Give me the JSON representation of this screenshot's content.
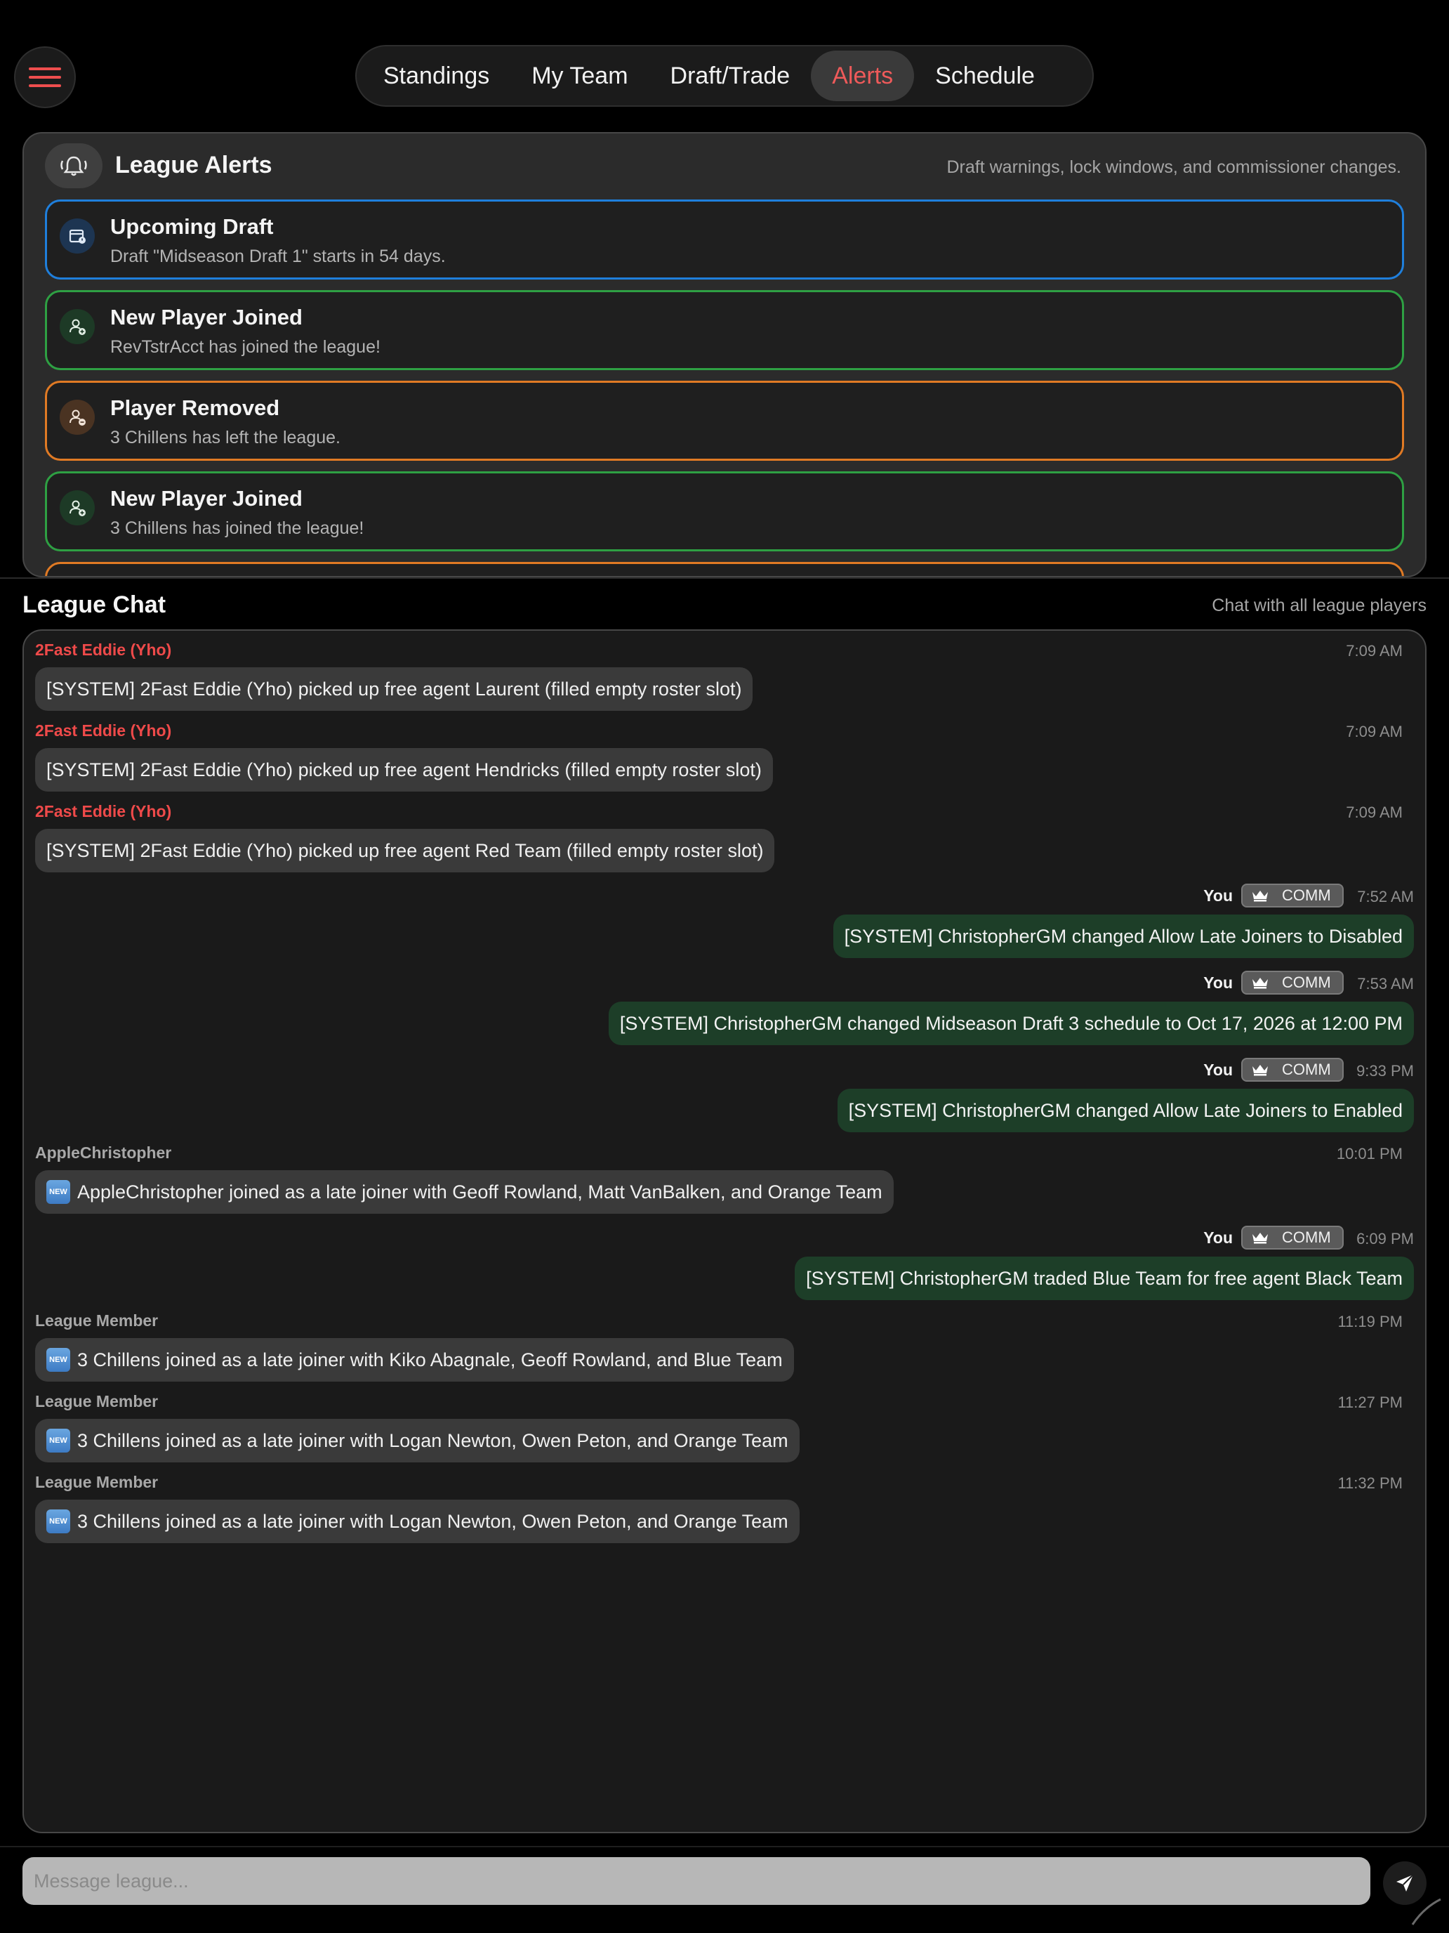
{
  "nav": {
    "tabs": [
      {
        "label": "Standings"
      },
      {
        "label": "My Team"
      },
      {
        "label": "Draft/Trade"
      },
      {
        "label": "Alerts"
      },
      {
        "label": "Schedule"
      }
    ],
    "active": "Alerts"
  },
  "alerts": {
    "title": "League Alerts",
    "subtitle": "Draft warnings, lock windows, and commissioner changes.",
    "items": [
      {
        "title": "Upcoming Draft",
        "desc": "Draft \"Midseason Draft 1\" starts in 54 days.",
        "type": "blue",
        "icon": "calendar-icon"
      },
      {
        "title": "New Player Joined",
        "desc": "RevTstrAcct has joined the league!",
        "type": "green",
        "icon": "user-add-icon"
      },
      {
        "title": "Player Removed",
        "desc": "3 Chillens has left the league.",
        "type": "orange",
        "icon": "user-remove-icon"
      },
      {
        "title": "New Player Joined",
        "desc": "3 Chillens has joined the league!",
        "type": "green",
        "icon": "user-add-icon"
      }
    ]
  },
  "chat": {
    "title": "League Chat",
    "subtitle": "Chat with all league players",
    "badge_label": "COMM",
    "new_emoji": "NEW",
    "messages": [
      {
        "sender": "2Fast Eddie (Yho)",
        "time": "7:09 AM",
        "text": "[SYSTEM] 2Fast Eddie (Yho) picked up free agent Laurent (filled empty roster slot)"
      },
      {
        "sender": "2Fast Eddie (Yho)",
        "time": "7:09 AM",
        "text": "[SYSTEM] 2Fast Eddie (Yho) picked up free agent Hendricks (filled empty roster slot)"
      },
      {
        "sender": "2Fast Eddie (Yho)",
        "time": "7:09 AM",
        "text": "[SYSTEM] 2Fast Eddie (Yho) picked up free agent Red Team (filled empty roster slot)"
      },
      {
        "sender": "You",
        "time": "7:52 AM",
        "text": "[SYSTEM] ChristopherGM changed Allow Late Joiners to Disabled"
      },
      {
        "sender": "You",
        "time": "7:53 AM",
        "text": "[SYSTEM] ChristopherGM changed Midseason Draft 3 schedule to Oct 17, 2026 at 12:00 PM"
      },
      {
        "sender": "You",
        "time": "9:33 PM",
        "text": "[SYSTEM] ChristopherGM changed Allow Late Joiners to Enabled"
      },
      {
        "sender": "AppleChristopher",
        "time": "10:01 PM",
        "text": "AppleChristopher joined as a late joiner with Geoff Rowland, Matt VanBalken, and Orange Team"
      },
      {
        "sender": "You",
        "time": "6:09 PM",
        "text": "[SYSTEM] ChristopherGM traded Blue Team for free agent Black Team"
      },
      {
        "sender": "League Member",
        "time": "11:19 PM",
        "text": "3 Chillens joined as a late joiner with Kiko Abagnale, Geoff Rowland, and Blue Team"
      },
      {
        "sender": "League Member",
        "time": "11:27 PM",
        "text": "3 Chillens joined as a late joiner with Logan Newton, Owen Peton, and Orange Team"
      },
      {
        "sender": "League Member",
        "time": "11:32 PM",
        "text": "3 Chillens joined as a late joiner with Logan Newton, Owen Peton, and Orange Team"
      }
    ]
  },
  "composer": {
    "placeholder": "Message league..."
  },
  "colors": {
    "accent": "#ef4e4e",
    "alert_blue": "#1f7fdc",
    "alert_green": "#2ea043",
    "alert_orange": "#e07a24",
    "own_bubble": "#1d3e28"
  }
}
